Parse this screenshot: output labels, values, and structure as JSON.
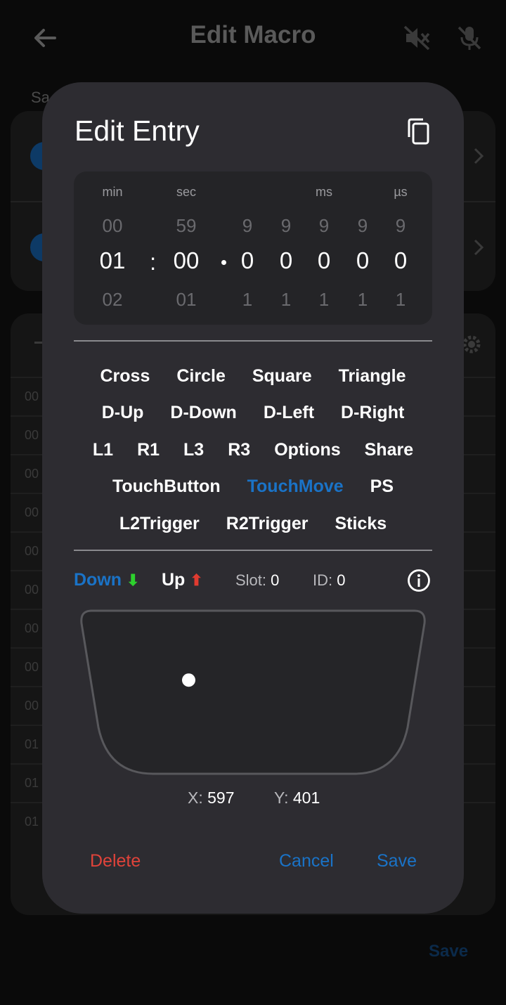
{
  "background": {
    "title": "Edit Macro",
    "label_partial": "Sa",
    "save_label": "Save",
    "row_prefixes": [
      "00",
      "00",
      "00",
      "00",
      "00",
      "00",
      "00",
      "00",
      "00",
      "01",
      "01",
      "01"
    ]
  },
  "dialog": {
    "title": "Edit Entry",
    "time_picker": {
      "headers": {
        "min": "min",
        "sec": "sec",
        "ms": "ms",
        "us": "µs"
      },
      "columns": [
        {
          "prev": "00",
          "selected": "01",
          "next": "02"
        },
        {
          "prev": "59",
          "selected": "00",
          "next": "01"
        },
        {
          "prev": "9",
          "selected": "0",
          "next": "1"
        },
        {
          "prev": "9",
          "selected": "0",
          "next": "1"
        },
        {
          "prev": "9",
          "selected": "0",
          "next": "1"
        },
        {
          "prev": "9",
          "selected": "0",
          "next": "1"
        },
        {
          "prev": "9",
          "selected": "0",
          "next": "1"
        }
      ],
      "colon": ":"
    },
    "buttons": [
      [
        "Cross",
        "Circle",
        "Square",
        "Triangle"
      ],
      [
        "D-Up",
        "D-Down",
        "D-Left",
        "D-Right"
      ],
      [
        "L1",
        "R1",
        "L3",
        "R3",
        "Options",
        "Share"
      ],
      [
        "TouchButton",
        "TouchMove",
        "PS"
      ],
      [
        "L2Trigger",
        "R2Trigger",
        "Sticks"
      ]
    ],
    "active_button": "TouchMove",
    "direction": {
      "down_label": "Down",
      "down_arrow": "⬇",
      "up_label": "Up",
      "up_arrow": "⬆",
      "selected": "Down"
    },
    "slot": {
      "label": "Slot:",
      "value": "0"
    },
    "id": {
      "label": "ID:",
      "value": "0"
    },
    "touch": {
      "x_label": "X:",
      "x": "597",
      "y_label": "Y:",
      "y": "401",
      "range_x": 1920,
      "range_y": 943
    },
    "actions": {
      "delete": "Delete",
      "cancel": "Cancel",
      "save": "Save"
    }
  },
  "colors": {
    "accent": "#1a73c7",
    "danger": "#e0433a",
    "down_arrow": "#2dd12d",
    "up_arrow": "#e03b30",
    "dialog_bg": "#2d2c31"
  }
}
